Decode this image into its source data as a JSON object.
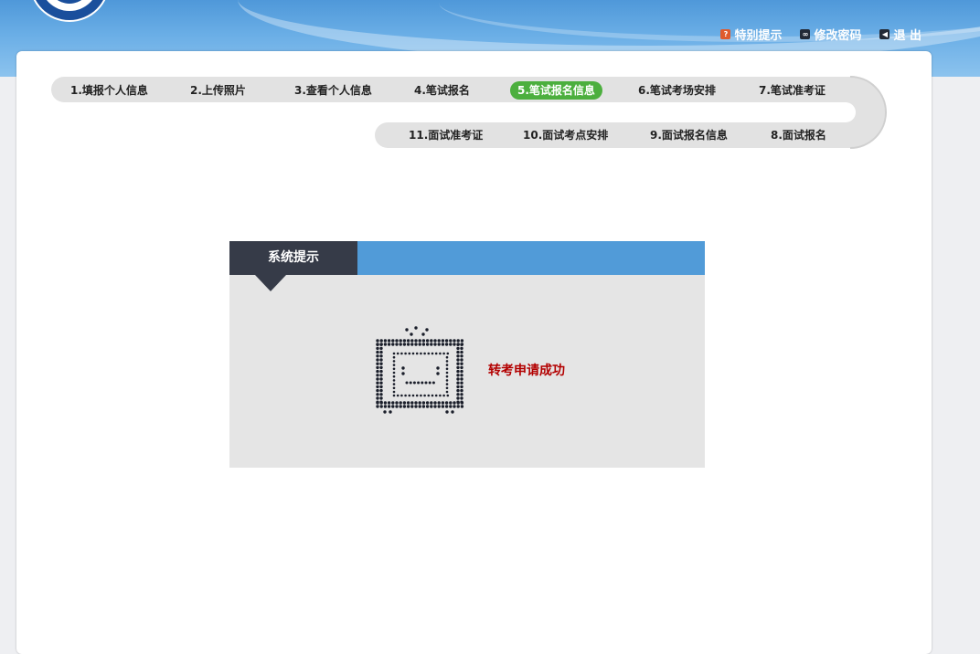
{
  "header": {
    "links": [
      {
        "label": "特别提示",
        "icon": "help-icon"
      },
      {
        "label": "修改密码",
        "icon": "password-icon"
      },
      {
        "label": "退 出",
        "icon": "exit-icon"
      }
    ]
  },
  "steps": {
    "row1": [
      {
        "label": "1.填报个人信息"
      },
      {
        "label": "2.上传照片"
      },
      {
        "label": "3.查看个人信息"
      },
      {
        "label": "4.笔试报名"
      },
      {
        "label": "5.笔试报名信息",
        "active": true
      },
      {
        "label": "6.笔试考场安排"
      },
      {
        "label": "7.笔试准考证"
      }
    ],
    "row2": [
      {
        "label": "11.面试准考证"
      },
      {
        "label": "10.面试考点安排"
      },
      {
        "label": "9.面试报名信息"
      },
      {
        "label": "8.面试报名"
      }
    ]
  },
  "dialog": {
    "title": "系统提示",
    "message": "转考申请成功",
    "icon": "tv-icon"
  },
  "colors": {
    "active_step": "#4caf3e",
    "dialog_bar": "#519bd8",
    "dialog_title_bg": "#363b48",
    "message": "#b30000"
  }
}
